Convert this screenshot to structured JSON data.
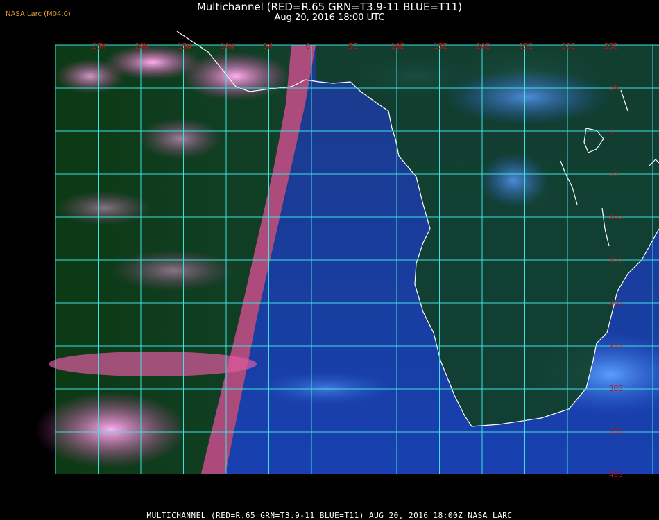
{
  "header": {
    "title": "Multichannel (RED=R.65 GRN=T3.9-11 BLUE=T11)",
    "subtitle": "Aug 20, 2016 18:00 UTC",
    "brand": "NASA Larc (M04.0)"
  },
  "footer": {
    "caption": "MULTICHANNEL (RED=R.65 GRN=T3.9-11 BLUE=T11) AUG 20, 2016 18:00Z   NASA LARC"
  },
  "map": {
    "longitude_labels": [
      "25W",
      "20W",
      "15W",
      "10W",
      "5W",
      "0",
      "5E",
      "10E",
      "15E",
      "20E",
      "25E",
      "30E",
      "35E"
    ],
    "latitude_labels": [
      "5N",
      "0",
      "5S",
      "10S",
      "15S",
      "20S",
      "25S",
      "30S",
      "35S",
      "40S"
    ],
    "grid_color": "#40e0e0",
    "label_color": "#c01010",
    "coastline_color": "#ffffff",
    "ocean_color": "#1a3fa0",
    "land_color": "#0f3a1a",
    "cloud_pink": "#ff6ad0",
    "cloud_blue": "#3a7bff"
  }
}
